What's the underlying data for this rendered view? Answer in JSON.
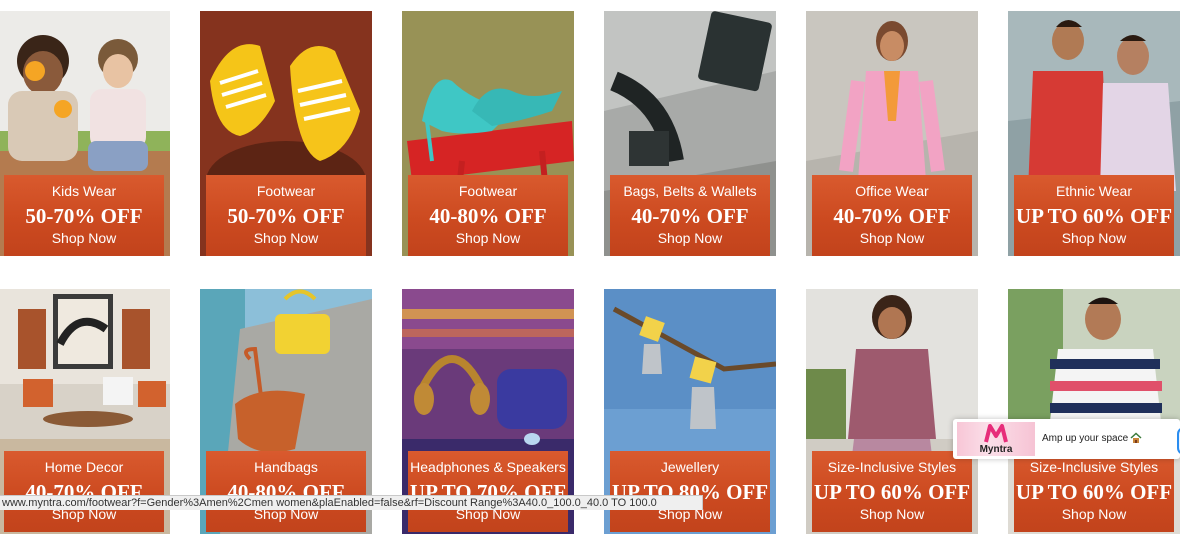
{
  "tiles_row1": [
    {
      "category": "Kids Wear",
      "discount": "50-70% OFF",
      "cta": "Shop Now"
    },
    {
      "category": "Footwear",
      "discount": "50-70% OFF",
      "cta": "Shop Now"
    },
    {
      "category": "Footwear",
      "discount": "40-80% OFF",
      "cta": "Shop Now"
    },
    {
      "category": "Bags, Belts & Wallets",
      "discount": "40-70% OFF",
      "cta": "Shop Now"
    },
    {
      "category": "Office Wear",
      "discount": "40-70% OFF",
      "cta": "Shop Now"
    },
    {
      "category": "Ethnic Wear",
      "discount": "UP TO 60% OFF",
      "cta": "Shop Now"
    }
  ],
  "tiles_row2": [
    {
      "category": "Home Decor",
      "discount": "40-70% OFF",
      "cta": "Shop Now"
    },
    {
      "category": "Handbags",
      "discount": "40-80% OFF",
      "cta": "Shop Now"
    },
    {
      "category": "Headphones & Speakers",
      "discount": "UP TO 70% OFF",
      "cta": "Shop Now"
    },
    {
      "category": "Jewellery",
      "discount": "UP TO 80% OFF",
      "cta": "Shop Now"
    },
    {
      "category": "Size-Inclusive Styles",
      "discount": "UP TO 60% OFF",
      "cta": "Shop Now"
    },
    {
      "category": "Size-Inclusive Styles",
      "discount": "UP TO 60% OFF",
      "cta": "Shop Now"
    }
  ],
  "status_url": "www.myntra.com/footwear?f=Gender%3Amen%2Cmen women&plaEnabled=false&rf=Discount Range%3A40.0_100.0_40.0 TO 100.0",
  "toast": {
    "app_name": "Myntra",
    "message": "Amp up your space"
  },
  "colors": {
    "offer_box": "#cc4a20",
    "brand_pink": "#e72d7a"
  }
}
